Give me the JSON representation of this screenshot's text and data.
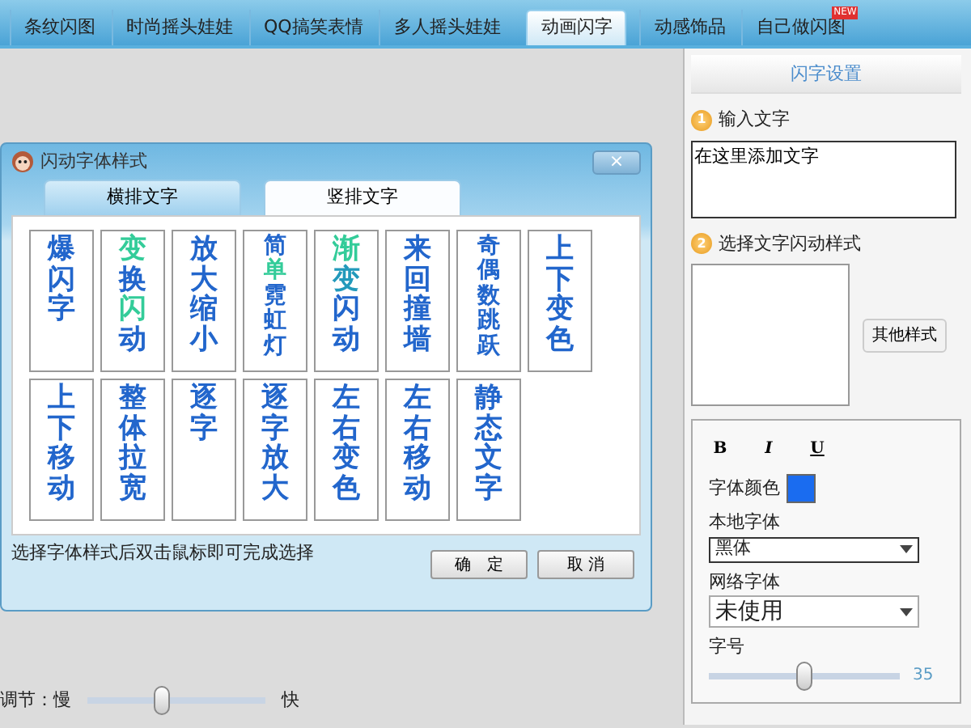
{
  "top_tabs": [
    {
      "label": "条纹闪图",
      "selected": false
    },
    {
      "label": "时尚摇头娃娃",
      "selected": false
    },
    {
      "label": "QQ搞笑表情",
      "selected": false
    },
    {
      "label": "多人摇头娃娃",
      "selected": false
    },
    {
      "label": "动画闪字",
      "selected": true
    },
    {
      "label": "动感饰品",
      "selected": false
    },
    {
      "label": "自己做闪图",
      "selected": false,
      "badge": "NEW"
    }
  ],
  "dialog": {
    "title": "闪动字体样式",
    "close": "×",
    "tabs": [
      {
        "label": "横排文字",
        "selected": false
      },
      {
        "label": "竖排文字",
        "selected": true
      }
    ],
    "styles": [
      {
        "chars": [
          {
            "ch": "爆",
            "color": "#2266cc"
          },
          {
            "ch": "闪",
            "color": "#2266cc"
          },
          {
            "ch": "字",
            "color": "#2266cc"
          }
        ]
      },
      {
        "chars": [
          {
            "ch": "变",
            "color": "#33cc99"
          },
          {
            "ch": "换",
            "color": "#2266cc"
          },
          {
            "ch": "闪",
            "color": "#33cc99"
          },
          {
            "ch": "动",
            "color": "#2266cc"
          }
        ]
      },
      {
        "chars": [
          {
            "ch": "放",
            "color": "#2266cc"
          },
          {
            "ch": "大",
            "color": "#2266cc"
          },
          {
            "ch": "缩",
            "color": "#2266cc"
          },
          {
            "ch": "小",
            "color": "#2266cc"
          }
        ]
      },
      {
        "chars": [
          {
            "ch": "简",
            "color": "#2266cc"
          },
          {
            "ch": "单",
            "color": "#33cc99"
          },
          {
            "ch": "霓",
            "color": "#2266cc"
          },
          {
            "ch": "虹",
            "color": "#2266cc"
          },
          {
            "ch": "灯",
            "color": "#2266cc"
          }
        ]
      },
      {
        "chars": [
          {
            "ch": "渐",
            "color": "#33cc99"
          },
          {
            "ch": "变",
            "color": "#2299bb"
          },
          {
            "ch": "闪",
            "color": "#2266cc"
          },
          {
            "ch": "动",
            "color": "#2266cc"
          }
        ]
      },
      {
        "chars": [
          {
            "ch": "来",
            "color": "#2266cc"
          },
          {
            "ch": "回",
            "color": "#2266cc"
          },
          {
            "ch": "撞",
            "color": "#2266cc"
          },
          {
            "ch": "墙",
            "color": "#2266cc"
          }
        ]
      },
      {
        "chars": [
          {
            "ch": "奇",
            "color": "#2266cc"
          },
          {
            "ch": "偶",
            "color": "#2266cc"
          },
          {
            "ch": "数",
            "color": "#2266cc"
          },
          {
            "ch": "跳",
            "color": "#2266cc"
          },
          {
            "ch": "跃",
            "color": "#2266cc"
          }
        ]
      },
      {
        "chars": [
          {
            "ch": "上",
            "color": "#2266cc"
          },
          {
            "ch": "下",
            "color": "#2266cc"
          },
          {
            "ch": "变",
            "color": "#2266cc"
          },
          {
            "ch": "色",
            "color": "#2266cc"
          }
        ]
      },
      {
        "chars": [
          {
            "ch": "上",
            "color": "#2266cc"
          },
          {
            "ch": "下",
            "color": "#2266cc"
          },
          {
            "ch": "移",
            "color": "#2266cc"
          },
          {
            "ch": "动",
            "color": "#2266cc"
          }
        ]
      },
      {
        "chars": [
          {
            "ch": "整",
            "color": "#2266cc"
          },
          {
            "ch": "体",
            "color": "#2266cc"
          },
          {
            "ch": "拉",
            "color": "#2266cc"
          },
          {
            "ch": "宽",
            "color": "#2266cc"
          }
        ]
      },
      {
        "chars": [
          {
            "ch": "逐",
            "color": "#2266cc"
          },
          {
            "ch": "字",
            "color": "#2266cc"
          }
        ]
      },
      {
        "chars": [
          {
            "ch": "逐",
            "color": "#2266cc"
          },
          {
            "ch": "字",
            "color": "#2266cc"
          },
          {
            "ch": "放",
            "color": "#2266cc"
          },
          {
            "ch": "大",
            "color": "#2266cc"
          }
        ]
      },
      {
        "chars": [
          {
            "ch": "左",
            "color": "#2266cc"
          },
          {
            "ch": "右",
            "color": "#2266cc"
          },
          {
            "ch": "变",
            "color": "#2266cc"
          },
          {
            "ch": "色",
            "color": "#2266cc"
          }
        ]
      },
      {
        "chars": [
          {
            "ch": "左",
            "color": "#2266cc"
          },
          {
            "ch": "右",
            "color": "#2266cc"
          },
          {
            "ch": "移",
            "color": "#2266cc"
          },
          {
            "ch": "动",
            "color": "#2266cc"
          }
        ]
      },
      {
        "chars": [
          {
            "ch": "静",
            "color": "#2266cc"
          },
          {
            "ch": "态",
            "color": "#2266cc"
          },
          {
            "ch": "文",
            "color": "#2266cc"
          },
          {
            "ch": "字",
            "color": "#2266cc"
          }
        ]
      }
    ],
    "hint": "选择字体样式后双击鼠标即可完成选择",
    "buttons": [
      "确　定",
      "取 消"
    ]
  },
  "speed": {
    "label": "调节：慢",
    "end_label": "快",
    "level": 0.42
  },
  "settings": {
    "title": "闪字设置",
    "step1": {
      "number": "1",
      "label": "输入文字",
      "value": "在这里添加文字"
    },
    "step2": {
      "number": "2",
      "label": "选择文字闪动样式",
      "button": "其他样式"
    },
    "format_buttons": [
      "B",
      "I",
      "U"
    ],
    "font_color": {
      "label": "字体颜色",
      "color": "#1a6cf0"
    },
    "local_font": {
      "label": "本地字体",
      "value": "黑体"
    },
    "web_font": {
      "label": "网络字体",
      "value": "未使用"
    },
    "size": {
      "label": "字号",
      "reading": "35",
      "level": 0.5
    }
  }
}
